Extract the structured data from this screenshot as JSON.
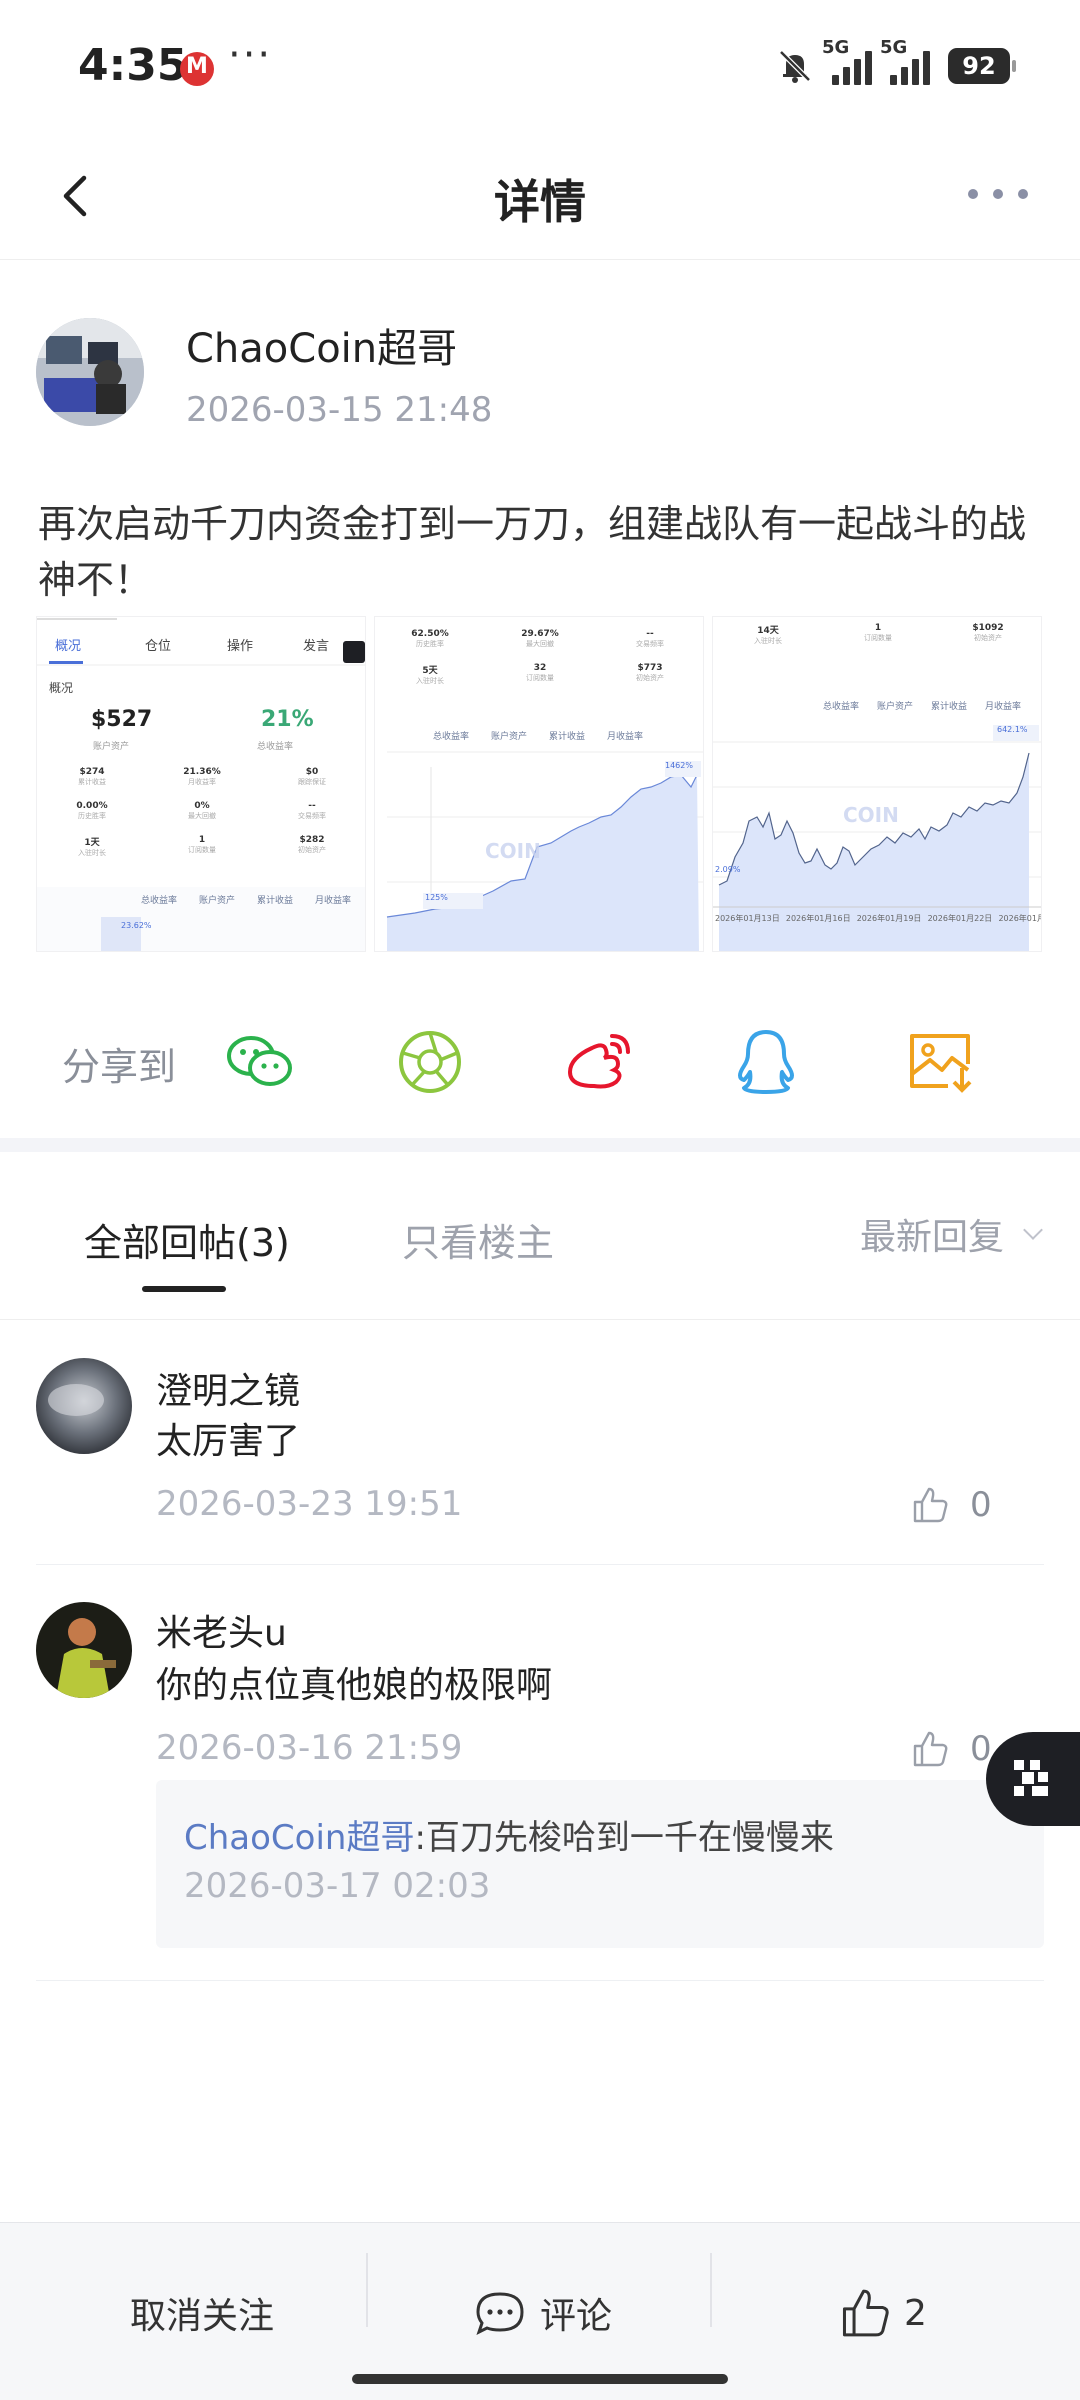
{
  "status_bar": {
    "time": "4:35",
    "dots": "···",
    "network_1": "5G",
    "network_2": "5G",
    "battery": "92"
  },
  "header": {
    "title": "详情"
  },
  "post": {
    "author": "ChaoCoin超哥",
    "timestamp": "2026-03-15 21:48",
    "text": "再次启动千刀内资金打到一万刀，组建战队有一起战斗的战神不！",
    "images": [
      {
        "tabs": [
          "概况",
          "仓位",
          "操作",
          "发言"
        ],
        "section": "概况",
        "balance": "$527",
        "balance_label": "账户资产",
        "rate": "21%",
        "rate_label": "总收益率",
        "stats": [
          {
            "v": "$274",
            "l": "累计收益"
          },
          {
            "v": "21.36%",
            "l": "月收益率"
          },
          {
            "v": "$0",
            "l": "跟踪保证"
          },
          {
            "v": "0.00%",
            "l": "历史胜率"
          },
          {
            "v": "0%",
            "l": "最大回撤"
          },
          {
            "v": "--",
            "l": "交易频率"
          },
          {
            "v": "1天",
            "l": "入驻时长"
          },
          {
            "v": "1",
            "l": "订阅数量"
          },
          {
            "v": "$282",
            "l": "初始资产"
          }
        ],
        "chart_tabs": [
          "总收益率",
          "账户资产",
          "累计收益",
          "月收益率"
        ],
        "annotation": "23.62%"
      },
      {
        "stats": [
          {
            "v": "62.50%",
            "l": "历史胜率"
          },
          {
            "v": "29.67%",
            "l": "最大回撤"
          },
          {
            "v": "--",
            "l": "交易频率"
          },
          {
            "v": "5天",
            "l": "入驻时长"
          },
          {
            "v": "32",
            "l": "订阅数量"
          },
          {
            "v": "$773",
            "l": "初始资产"
          }
        ],
        "chart_tabs": [
          "总收益率",
          "账户资产",
          "累计收益",
          "月收益率"
        ],
        "peak": "1462%",
        "start": "125%",
        "watermark": "COIN"
      },
      {
        "stats": [
          {
            "v": "14天",
            "l": "入驻时长"
          },
          {
            "v": "1",
            "l": "订阅数量"
          },
          {
            "v": "$1092",
            "l": "初始资产"
          }
        ],
        "chart_tabs": [
          "总收益率",
          "账户资产",
          "累计收益",
          "月收益率"
        ],
        "peak": "642.1%",
        "start": "2.09%",
        "watermark": "COIN",
        "x_ticks": [
          "2026年01月13日",
          "2026年01月16日",
          "2026年01月19日",
          "2026年01月22日",
          "2026年01月"
        ]
      }
    ]
  },
  "share": {
    "label": "分享到",
    "targets": [
      "wechat-icon",
      "moments-icon",
      "weibo-icon",
      "qq-icon",
      "save-image-icon"
    ],
    "colors": {
      "wechat": "#2bb24c",
      "moments": "#8cc63f",
      "weibo": "#e6162d",
      "qq": "#3aa4e8",
      "save": "#f0a21d"
    }
  },
  "tabs": {
    "all": "全部回帖(3)",
    "op_only": "只看楼主",
    "sort": "最新回复"
  },
  "replies": [
    {
      "name": "澄明之镜",
      "text": "太厉害了",
      "time": "2026-03-23 19:51",
      "likes": "0"
    },
    {
      "name": "米老头u",
      "text": "你的点位真他娘的极限啊",
      "time": "2026-03-16 21:59",
      "likes": "0",
      "sub_reply": {
        "author": "ChaoCoin超哥",
        "text": ":百刀先梭哈到一千在慢慢来",
        "time": "2026-03-17 02:03"
      }
    }
  ],
  "bottom_bar": {
    "unfollow": "取消关注",
    "comment": "评论",
    "likes": "2"
  }
}
